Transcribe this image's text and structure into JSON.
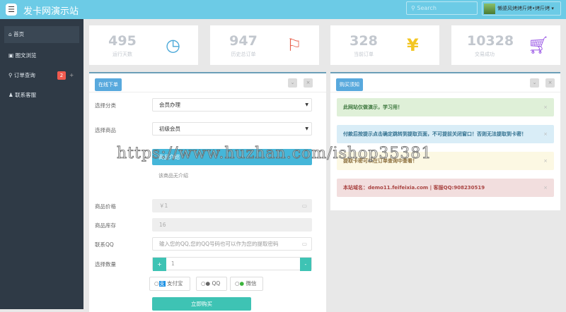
{
  "header": {
    "title": "发卡网演示站",
    "search_placeholder": "Search",
    "user": "懒婆风烤烤斤烤•烤斤烤"
  },
  "sidebar": {
    "items": [
      {
        "label": "首页",
        "icon": "home-icon"
      },
      {
        "label": "图文浏览",
        "icon": "image-icon"
      },
      {
        "label": "订单查询",
        "icon": "search-icon",
        "badge": "2"
      },
      {
        "label": "联系客服",
        "icon": "user-icon"
      }
    ]
  },
  "stats": [
    {
      "value": "495",
      "label": "运行天数",
      "icon": "clock-icon",
      "color": "#4aa8d8"
    },
    {
      "value": "947",
      "label": "历史总订单",
      "icon": "flag-icon",
      "color": "#e8604c"
    },
    {
      "value": "328",
      "label": "当前订单",
      "icon": "yen-icon",
      "color": "#f3c623"
    },
    {
      "value": "10328",
      "label": "交易成功",
      "icon": "cart-icon",
      "color": "#9b59e6"
    }
  ],
  "order": {
    "title": "在线下单",
    "category_label": "选择分类",
    "category_value": "会员办理",
    "product_label": "选择商品",
    "product_value": "初级会员",
    "intro_bar": "商品介绍",
    "no_intro": "该商品无介绍",
    "price_label": "商品价格",
    "price_value": "￥1",
    "stock_label": "商品库存",
    "stock_value": "16",
    "qq_label": "联系QQ",
    "qq_placeholder": "输入您的QQ,您的QQ号码也可以作为您的提取密码",
    "qty_label": "选择数量",
    "qty_value": "1",
    "plus": "+",
    "minus": "-",
    "pay_methods": [
      "支付宝",
      "QQ",
      "微信"
    ],
    "buy": "立即购买"
  },
  "notice": {
    "title": "购买须知",
    "alerts": [
      "此网站仅做演示，学习用！",
      "付款后按提示点击确定跳转到提取页面，不可提前关闭窗口！否则无法提取到卡密！",
      "提取卡密可以在订单查询中查看！",
      "本站域名：demo11.feifeixia.com | 客服QQ:908230519"
    ]
  },
  "watermark": "https://www.huzhan.com/ishop35381"
}
